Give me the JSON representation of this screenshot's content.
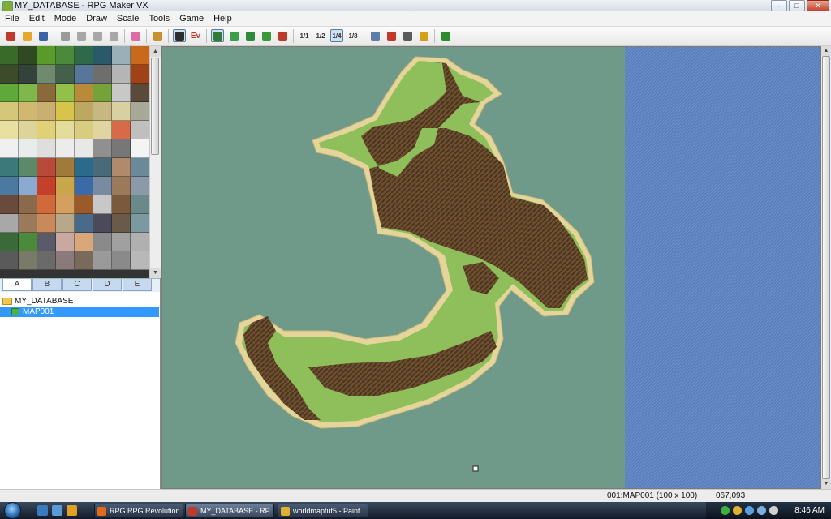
{
  "window": {
    "title": "MY_DATABASE - RPG Maker VX"
  },
  "menu": [
    "File",
    "Edit",
    "Mode",
    "Draw",
    "Scale",
    "Tools",
    "Game",
    "Help"
  ],
  "toolbar": {
    "groups": [
      [
        {
          "name": "new-project",
          "icon": "new-project-icon",
          "color": "#c0392b"
        },
        {
          "name": "open-project",
          "icon": "folder-open-icon",
          "color": "#e6a82c"
        },
        {
          "name": "save-project",
          "icon": "save-icon",
          "color": "#3c63a8"
        }
      ],
      [
        {
          "name": "cut",
          "icon": "scissors-icon",
          "color": "#9a9a9a"
        },
        {
          "name": "copy",
          "icon": "copy-icon",
          "color": "#a7a7a7"
        },
        {
          "name": "paste",
          "icon": "paste-icon",
          "color": "#a7a7a7"
        },
        {
          "name": "delete",
          "icon": "delete-icon",
          "color": "#a7a7a7"
        }
      ],
      [
        {
          "name": "undo",
          "icon": "undo-icon",
          "color": "#e06aa6"
        }
      ],
      [
        {
          "name": "database",
          "icon": "database-icon",
          "color": "#c8902a"
        }
      ],
      [
        {
          "name": "map-mode",
          "icon": "map-mode-icon",
          "color": "#2e2e2e",
          "active": true
        },
        {
          "name": "event-mode",
          "icon": "event-mode-icon",
          "color": "#c0392b",
          "text": "Ev"
        }
      ],
      [
        {
          "name": "pencil",
          "icon": "pencil-icon",
          "color": "#2e7d32",
          "active": true
        },
        {
          "name": "rectangle",
          "icon": "rectangle-icon",
          "color": "#3aa04a"
        },
        {
          "name": "ellipse",
          "icon": "ellipse-icon",
          "color": "#2e8b3a"
        },
        {
          "name": "fill",
          "icon": "fill-icon",
          "color": "#3a9a3a"
        },
        {
          "name": "shadow-pen",
          "icon": "shadow-pen-icon",
          "color": "#c0392b"
        }
      ],
      [
        {
          "name": "scale-1-1",
          "icon": "scale-1-1-icon",
          "color": "#333",
          "text": "1/1"
        },
        {
          "name": "scale-1-2",
          "icon": "scale-1-2-icon",
          "color": "#333",
          "text": "1/2"
        },
        {
          "name": "scale-1-4",
          "icon": "scale-1-4-icon",
          "color": "#333",
          "text": "1/4",
          "active": true
        },
        {
          "name": "scale-1-8",
          "icon": "scale-1-8-icon",
          "color": "#333",
          "text": "1/8"
        }
      ],
      [
        {
          "name": "resource-manager",
          "icon": "resource-manager-icon",
          "color": "#5a7fa8"
        },
        {
          "name": "script-editor",
          "icon": "script-editor-icon",
          "color": "#c0392b"
        },
        {
          "name": "sound-test",
          "icon": "sound-test-icon",
          "color": "#5a5a5a"
        },
        {
          "name": "character-generator",
          "icon": "key-icon",
          "color": "#d4a018"
        }
      ],
      [
        {
          "name": "playtest",
          "icon": "play-icon",
          "color": "#2e8b2e"
        }
      ]
    ]
  },
  "palette": {
    "tiles": [
      "#3a6a2a",
      "#2f4a22",
      "#5a9a2a",
      "#4a8a3a",
      "#2e6a4a",
      "#2a5a6a",
      "#9ab0b8",
      "#c86a1a",
      "#3c4c2a",
      "#33423a",
      "#6f8a6f",
      "#45604a",
      "#58769a",
      "#6e6e6e",
      "#b5b5b5",
      "#a04218",
      "#5fa83a",
      "#7fb84a",
      "#8a6a3a",
      "#93c04a",
      "#b88a3a",
      "#76a23a",
      "#c8c8c8",
      "#5a4a3a",
      "#d4c878",
      "#d0b870",
      "#c9b070",
      "#d8c44a",
      "#bca860",
      "#c6b880",
      "#d8d0a0",
      "#a8a898",
      "#e8e0a0",
      "#dcd49a",
      "#e0d078",
      "#e4dc9a",
      "#d8cc80",
      "#e0d4a0",
      "#d86a4a",
      "#bfbfbf",
      "#f0f0f0",
      "#e8ecec",
      "#dedede",
      "#ececec",
      "#e8e8e8",
      "#909090",
      "#777777",
      "#f4f4f4",
      "#3a7a7a",
      "#5a8a6a",
      "#b84a3a",
      "#a07a3a",
      "#2a6a8a",
      "#4a6a7a",
      "#b08a6a",
      "#6a8a9a",
      "#4a7aa0",
      "#8aaad0",
      "#c4402a",
      "#caa64a",
      "#3a6aa8",
      "#7a8aa0",
      "#9a7a5a",
      "#8a9aa8",
      "#6a4a3a",
      "#8a6a4a",
      "#d06a3a",
      "#d4a060",
      "#9a5a2a",
      "#c8c8c8",
      "#7a5a3a",
      "#6a8a8a",
      "#a8a8a8",
      "#9a7a5a",
      "#c88a5a",
      "#b8a88a",
      "#4a6a8a",
      "#4a4a5a",
      "#6a5a4a",
      "#7a9aa0",
      "#3a6a3a",
      "#4a8a3a",
      "#5a5a6a",
      "#c8a8a0",
      "#d8a87a",
      "#8a8a8a",
      "#a0a0a0",
      "#b0b0b0",
      "#5a5a5a",
      "#7a7a6a",
      "#6a6a6a",
      "#8a7a7a",
      "#7a6a5a",
      "#9a9a9a",
      "#8a8a8a",
      "#b8b8b8"
    ]
  },
  "tabs": [
    "A",
    "B",
    "C",
    "D",
    "E"
  ],
  "tree": {
    "root": "MY_DATABASE",
    "map": "MAP001"
  },
  "status": {
    "map_info": "001:MAP001 (100 x 100)",
    "coords": "067,093"
  },
  "taskbar": {
    "tasks": [
      {
        "label": "RPG RPG Revolution...",
        "icon_color": "#e46a1a"
      },
      {
        "label": "MY_DATABASE - RP...",
        "icon_color": "#c0392b",
        "active": true
      },
      {
        "label": "worldmaptut5 - Paint",
        "icon_color": "#e0b030"
      }
    ],
    "quicklaunch_colors": [
      "#3a7abf",
      "#5a9ad8",
      "#e0a028"
    ],
    "tray_colors": [
      "#3cb043",
      "#e0b030",
      "#5aa0e0",
      "#7ab0e0",
      "#cfcfcf"
    ],
    "clock": "8:46 AM"
  },
  "colors": {
    "grass": "#8fbf5a",
    "grass_dark": "#76a046",
    "sand": "#e6d59a",
    "dirt": "#6e5030",
    "dirt_dark": "#4a341e",
    "shallow": "#6f9a8a",
    "deep": "#5a7fbc"
  }
}
